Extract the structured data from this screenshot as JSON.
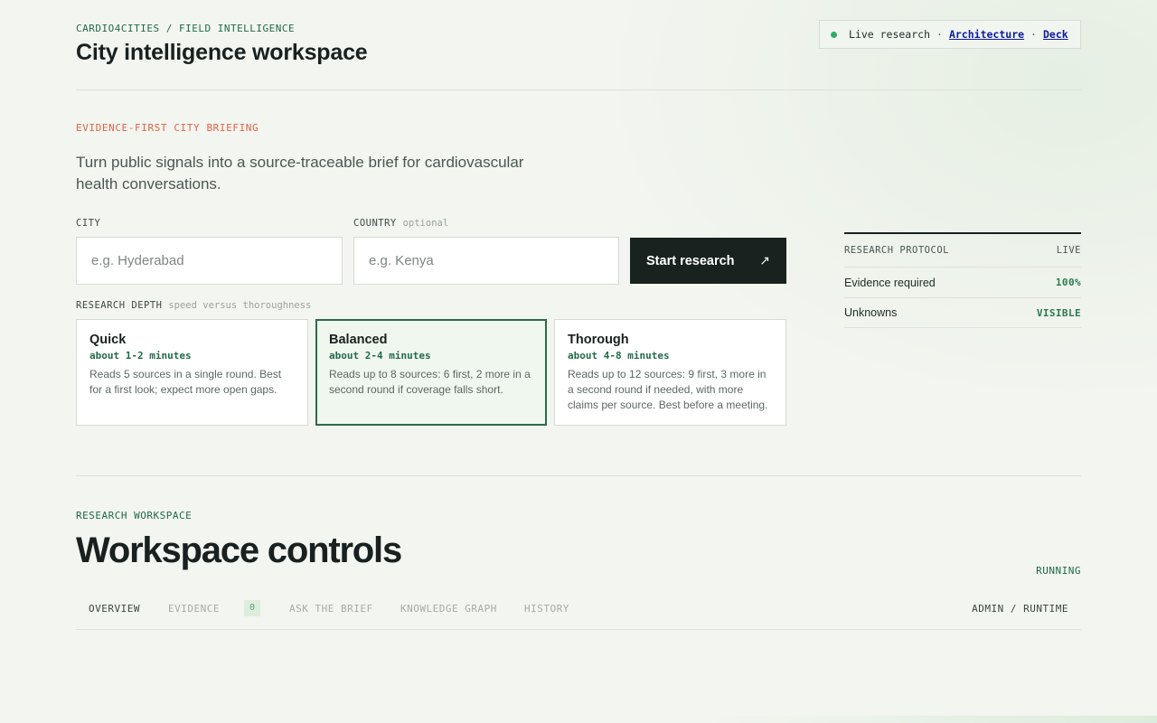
{
  "header": {
    "breadcrumb": "CARDIO4CITIES / FIELD INTELLIGENCE",
    "title": "City intelligence workspace",
    "status": {
      "live_label": "Live research",
      "separator": "·",
      "links": [
        "Architecture",
        "Deck"
      ],
      "dot_color": "#37a86a"
    }
  },
  "briefing": {
    "eyebrow": "EVIDENCE-FIRST CITY BRIEFING",
    "lede": "Turn public signals into a source-traceable brief for cardiovascular health conversations.",
    "city": {
      "label": "CITY",
      "placeholder": "e.g. Hyderabad",
      "value": ""
    },
    "country": {
      "label": "COUNTRY",
      "optional": "optional",
      "placeholder": "e.g. Kenya",
      "value": ""
    },
    "start_button": {
      "label": "Start research",
      "icon": "arrow-up-right-icon",
      "glyph": "↗"
    },
    "depth": {
      "label": "RESEARCH DEPTH",
      "hint": "speed versus thoroughness",
      "selected": "Balanced",
      "options": [
        {
          "title": "Quick",
          "time": "about 1-2 minutes",
          "description": "Reads 5 sources in a single round. Best for a first look; expect more open gaps."
        },
        {
          "title": "Balanced",
          "time": "about 2-4 minutes",
          "description": "Reads up to 8 sources: 6 first, 2 more in a second round if coverage falls short."
        },
        {
          "title": "Thorough",
          "time": "about 4-8 minutes",
          "description": "Reads up to 12 sources: 9 first, 3 more in a second round if needed, with more claims per source. Best before a meeting."
        }
      ]
    }
  },
  "protocol": {
    "title": "RESEARCH PROTOCOL",
    "status": "LIVE",
    "rows": [
      {
        "label": "Evidence required",
        "value": "100%"
      },
      {
        "label": "Unknowns",
        "value": "VISIBLE"
      }
    ]
  },
  "workspace": {
    "eyebrow": "RESEARCH WORKSPACE",
    "title": "Workspace controls",
    "status": "RUNNING",
    "tabs": [
      {
        "label": "OVERVIEW"
      },
      {
        "label": "EVIDENCE",
        "count": "0"
      },
      {
        "label": "ASK THE BRIEF"
      },
      {
        "label": "KNOWLEDGE GRAPH"
      },
      {
        "label": "HISTORY"
      }
    ],
    "active_tab": "OVERVIEW",
    "admin_link": "ADMIN / RUNTIME"
  },
  "colors": {
    "accent_green": "#1f6a45",
    "accent_orange": "#e06446",
    "dark": "#182320",
    "selected_bg": "#eff7ee"
  }
}
